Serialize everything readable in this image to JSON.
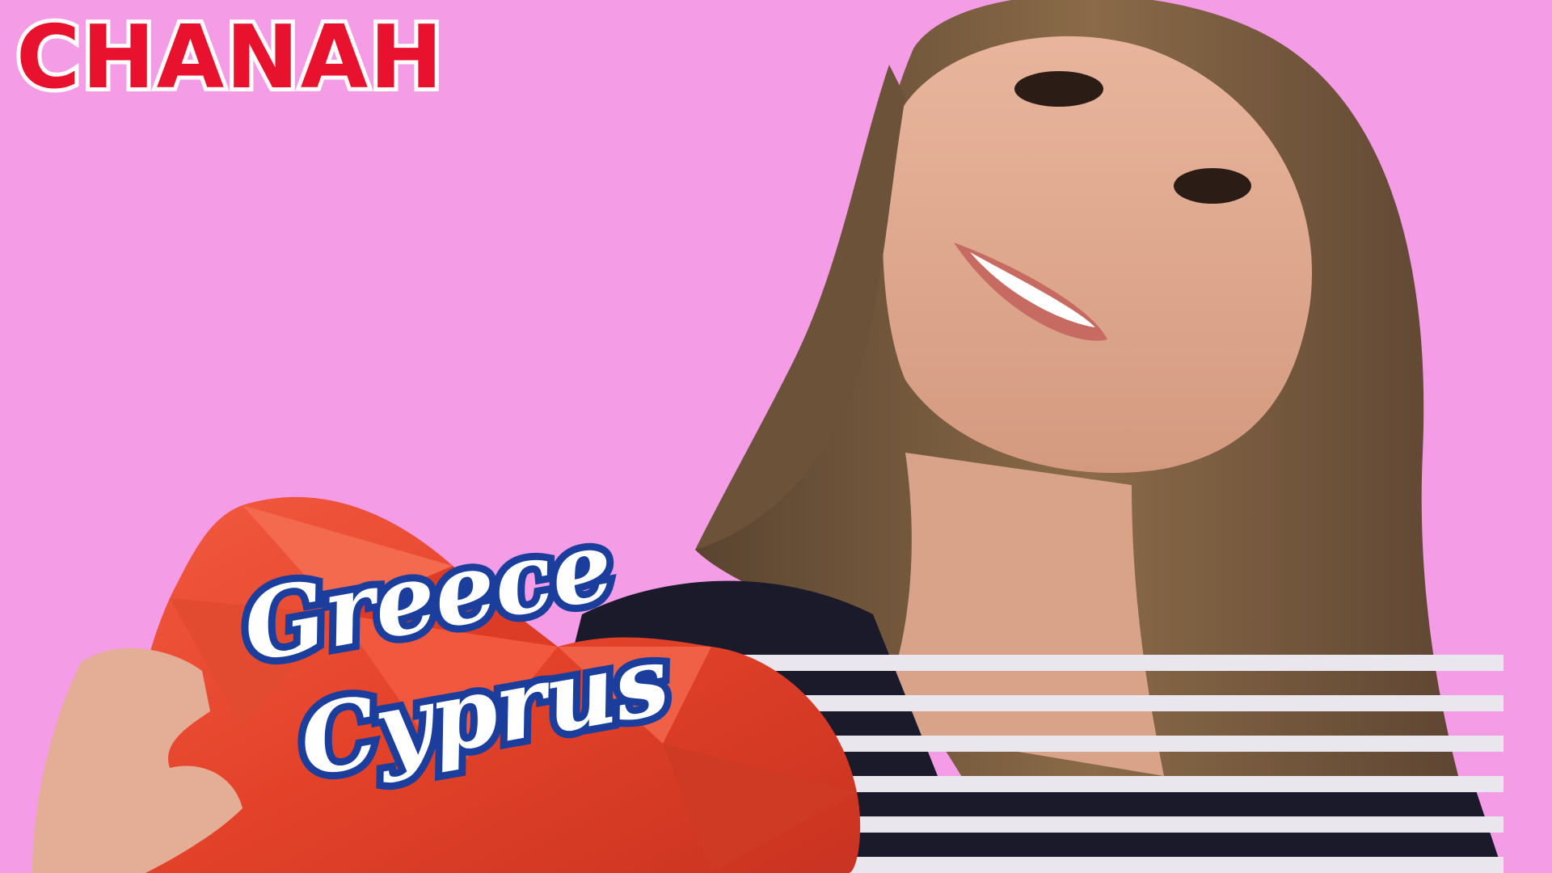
{
  "title": "CHANAH",
  "caption": {
    "line1": "Greece",
    "line2": "Cyprus"
  },
  "colors": {
    "background": "#f59ce6",
    "title_fill": "#e8122e",
    "title_outline": "#ffffff",
    "caption_fill": "#ffffff",
    "caption_outline": "#1b3e9c",
    "heart": "#e8432f"
  }
}
